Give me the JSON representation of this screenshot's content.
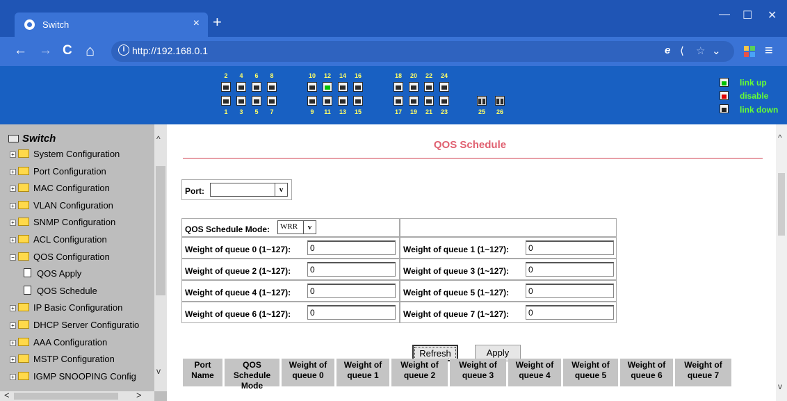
{
  "browser": {
    "tab_title": "Switch",
    "tab_close": "×",
    "new_tab": "+",
    "url": "http://192.168.0.1",
    "info_icon": "i",
    "window_controls": [
      "—",
      "☐",
      "✕"
    ],
    "nav_icons": [
      "←",
      "→",
      "C",
      "⌂"
    ],
    "url_right_icons": [
      "e",
      "⟨",
      "☆",
      "⌄"
    ],
    "menu": "≡"
  },
  "panel": {
    "top_ports": [
      "2",
      "4",
      "6",
      "8",
      "10",
      "12",
      "14",
      "16",
      "18",
      "20",
      "22",
      "24"
    ],
    "bottom_ports": [
      "1",
      "3",
      "5",
      "7",
      "9",
      "11",
      "13",
      "15",
      "17",
      "19",
      "21",
      "23"
    ],
    "sfp_ports": [
      "25",
      "26"
    ],
    "link_up_port": "12",
    "legend": {
      "up": "link up",
      "disable": "disable",
      "down": "link down"
    },
    "colors": {
      "background": "#1860c2",
      "port_numbers": "#ffff66",
      "legend_text": "#66ff33",
      "link_up": "#00c000",
      "disable": "#e00000"
    }
  },
  "tree": {
    "root": "Switch",
    "items": [
      {
        "label": "System Configuration",
        "type": "folder",
        "expander": "+"
      },
      {
        "label": "Port Configuration",
        "type": "folder",
        "expander": "+"
      },
      {
        "label": "MAC Configuration",
        "type": "folder",
        "expander": "+"
      },
      {
        "label": "VLAN Configuration",
        "type": "folder",
        "expander": "+"
      },
      {
        "label": "SNMP Configuration",
        "type": "folder",
        "expander": "+"
      },
      {
        "label": "ACL Configuration",
        "type": "folder",
        "expander": "+"
      },
      {
        "label": "QOS Configuration",
        "type": "folder-open",
        "expander": "−"
      },
      {
        "label": "QOS Apply",
        "type": "doc"
      },
      {
        "label": "QOS Schedule",
        "type": "doc"
      },
      {
        "label": "IP Basic Configuration",
        "type": "folder",
        "expander": "+"
      },
      {
        "label": "DHCP Server Configuratio",
        "type": "folder",
        "expander": "+"
      },
      {
        "label": "AAA Configuration",
        "type": "folder",
        "expander": "+"
      },
      {
        "label": "MSTP Configuration",
        "type": "folder",
        "expander": "+"
      },
      {
        "label": "IGMP SNOOPING Config",
        "type": "folder",
        "expander": "+"
      }
    ]
  },
  "main": {
    "title": "QOS Schedule",
    "port_label": "Port:",
    "port_value": "",
    "mode_label": "QOS Schedule Mode:",
    "mode_value": "WRR",
    "weights": [
      {
        "label": "Weight of queue 0 (1~127):",
        "value": "0"
      },
      {
        "label": "Weight of queue 1 (1~127):",
        "value": "0"
      },
      {
        "label": "Weight of queue 2 (1~127):",
        "value": "0"
      },
      {
        "label": "Weight of queue 3 (1~127):",
        "value": "0"
      },
      {
        "label": "Weight of queue 4 (1~127):",
        "value": "0"
      },
      {
        "label": "Weight of queue 5 (1~127):",
        "value": "0"
      },
      {
        "label": "Weight of queue 6 (1~127):",
        "value": "0"
      },
      {
        "label": "Weight of queue 7 (1~127):",
        "value": "0"
      }
    ],
    "refresh": "Refresh",
    "apply": "Apply",
    "table_headers": [
      [
        "Port",
        "Name"
      ],
      [
        "QOS Schedule",
        "Mode"
      ],
      [
        "Weight of",
        "queue 0"
      ],
      [
        "Weight of",
        "queue 1"
      ],
      [
        "Weight of",
        "queue 2"
      ],
      [
        "Weight of",
        "queue 3"
      ],
      [
        "Weight of",
        "queue 4"
      ],
      [
        "Weight of",
        "queue 5"
      ],
      [
        "Weight of",
        "queue 6"
      ],
      [
        "Weight of",
        "queue 7"
      ]
    ],
    "title_color": "#e06070"
  }
}
